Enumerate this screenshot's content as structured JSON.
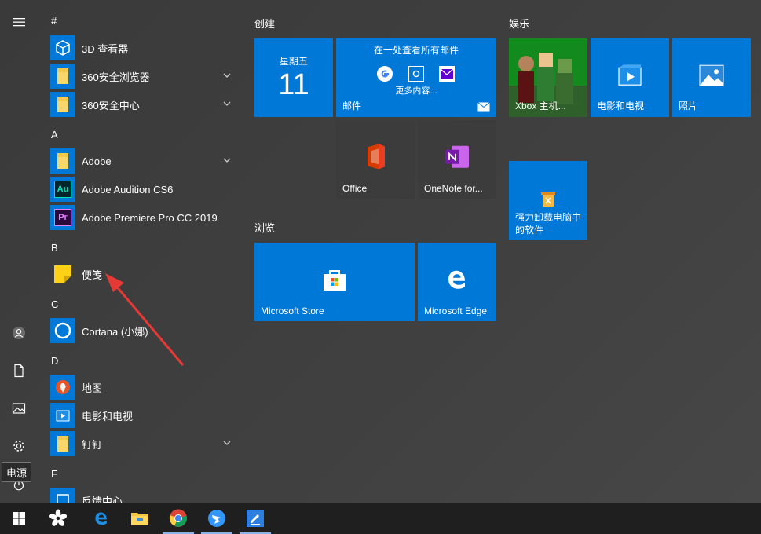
{
  "tooltip": "电源",
  "applist": {
    "groups": [
      "#",
      "A",
      "B",
      "C",
      "D",
      "F"
    ],
    "apps": [
      {
        "label": "3D 查看器"
      },
      {
        "label": "360安全浏览器"
      },
      {
        "label": "360安全中心"
      },
      {
        "label": "Adobe"
      },
      {
        "label": "Adobe Audition CS6"
      },
      {
        "label": "Adobe Premiere Pro CC 2019"
      },
      {
        "label": "便笺"
      },
      {
        "label": "Cortana (小娜)"
      },
      {
        "label": "地图"
      },
      {
        "label": "电影和电视"
      },
      {
        "label": "钉钉"
      },
      {
        "label": "反馈中心"
      }
    ],
    "icon_glyphs": {
      "audition": "Au",
      "premiere": "Pr"
    }
  },
  "sections": {
    "create": "创建",
    "entertainment": "娱乐",
    "browse": "浏览"
  },
  "tiles": {
    "calendar_day": "星期五",
    "calendar_date": "11",
    "mail_header": "在一处查看所有邮件",
    "mail_more": "更多内容...",
    "mail_label": "邮件",
    "office": "Office",
    "onenote": "OneNote for...",
    "xbox": "Xbox 主机...",
    "movies": "电影和电视",
    "photos": "照片",
    "uninstall": "强力卸载电脑中的软件",
    "store": "Microsoft Store",
    "edge": "Microsoft Edge"
  },
  "colors": {
    "tile_blue": "#0078d7",
    "annotation_arrow": "#e53935",
    "premiere_bg": "#2a0a3a",
    "audition_bg": "#00262b",
    "onenote_purple": "#7719aa",
    "office_red": "#d83b01"
  },
  "taskbar": {
    "icons": [
      "windows-start-icon",
      "task-view-icon",
      "edge-icon",
      "file-explorer-icon",
      "chrome-icon",
      "dingtalk-icon",
      "notes-app-icon"
    ]
  }
}
